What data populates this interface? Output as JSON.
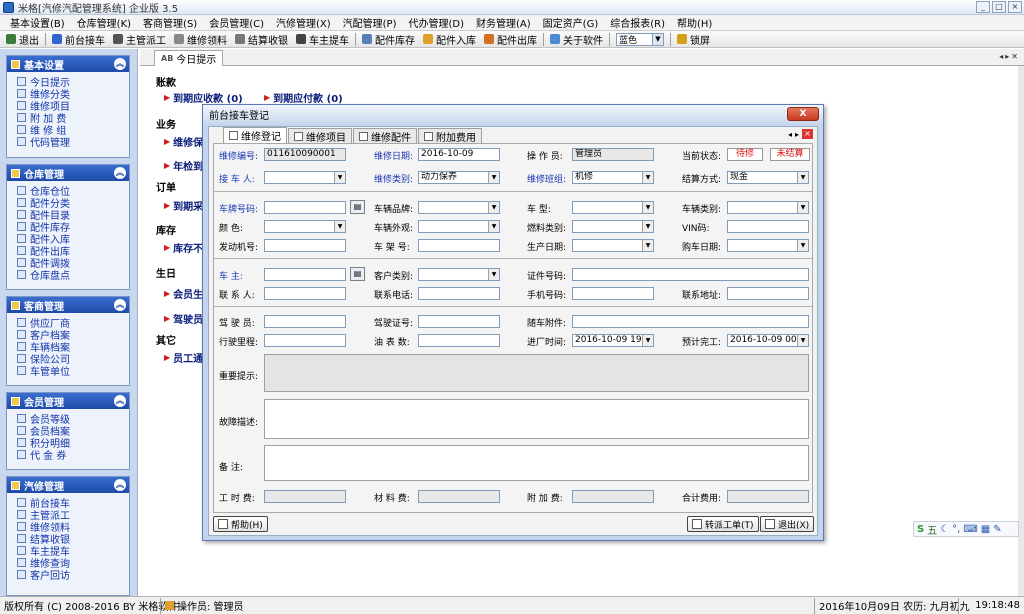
{
  "window": {
    "title": "米格[汽修汽配管理系统] 企业版 3.5"
  },
  "menu": [
    "基本设置(B)",
    "仓库管理(K)",
    "客商管理(S)",
    "会员管理(C)",
    "汽修管理(X)",
    "汽配管理(P)",
    "代办管理(D)",
    "财务管理(A)",
    "固定资产(G)",
    "综合报表(R)",
    "帮助(H)"
  ],
  "toolbar": {
    "items": [
      "退出",
      "前台接车",
      "主管派工",
      "维修领料",
      "结算收银",
      "车主提车",
      "配件库存",
      "配件入库",
      "配件出库",
      "关于软件"
    ],
    "theme_value": "蓝色",
    "lock_label": "锁屏"
  },
  "sidebar": {
    "panels": [
      {
        "title": "基本设置",
        "items": [
          "今日提示",
          "维修分类",
          "维修项目",
          "附 加 费",
          "维 修 组",
          "代码管理"
        ]
      },
      {
        "title": "仓库管理",
        "items": [
          "仓库仓位",
          "配件分类",
          "配件目录",
          "配件库存",
          "配件入库",
          "配件出库",
          "配件调拨",
          "仓库盘点"
        ]
      },
      {
        "title": "客商管理",
        "items": [
          "供应厂商",
          "客户档案",
          "车辆档案",
          "保险公司",
          "车管单位"
        ]
      },
      {
        "title": "会员管理",
        "items": [
          "会员等级",
          "会员档案",
          "积分明细",
          "代 金 券"
        ]
      },
      {
        "title": "汽修管理",
        "items": [
          "前台接车",
          "主管派工",
          "维修领料",
          "结算收银",
          "车主提车",
          "维修查询",
          "客户回访"
        ]
      }
    ]
  },
  "tab": {
    "label": "今日提示",
    "icon_text": "AB"
  },
  "reminders": {
    "sections": {
      "s1": "账款",
      "s2": "业务",
      "s3": "订单",
      "s4": "库存",
      "s5": "生日",
      "s6": "其它"
    },
    "links": {
      "l1": "到期应收款 (0)",
      "l2": "到期应付款 (0)",
      "l3": "维修保",
      "l4": "年检到",
      "l5": "到期采",
      "l6": "库存不",
      "l7": "会员生",
      "l8": "驾驶员",
      "l9": "员工通"
    }
  },
  "dialog": {
    "title": "前台接车登记",
    "close_label": "X",
    "tabs": [
      "维修登记",
      "维修项目",
      "维修配件",
      "附加费用"
    ],
    "form": {
      "wxbh": {
        "label": "维修编号:",
        "value": "011610090001"
      },
      "wxrq": {
        "label": "维修日期:",
        "value": "2016-10-09"
      },
      "czy": {
        "label": "操 作 员:",
        "value": "管理员"
      },
      "dqzt": {
        "label": "当前状态:",
        "status1": "待修",
        "status2": "未结算"
      },
      "jcr": {
        "label": "接 车 人:",
        "value": ""
      },
      "wxlb": {
        "label": "维修类别:",
        "value": "动力保养"
      },
      "wxbz": {
        "label": "维修班组:",
        "value": "机修"
      },
      "jsfs": {
        "label": "结算方式:",
        "value": "现金"
      },
      "cphm": {
        "label": "车牌号码:",
        "value": ""
      },
      "clpp": {
        "label": "车辆品牌:",
        "value": ""
      },
      "cx": {
        "label": "车 型:",
        "value": ""
      },
      "cllb": {
        "label": "车辆类别:",
        "value": ""
      },
      "ys": {
        "label": "颜 色:",
        "value": ""
      },
      "clwg": {
        "label": "车辆外观:",
        "value": ""
      },
      "rylb": {
        "label": "燃料类别:",
        "value": ""
      },
      "vin": {
        "label": "VIN码:",
        "value": ""
      },
      "fdjh": {
        "label": "发动机号:",
        "value": ""
      },
      "cjh": {
        "label": "车 架 号:",
        "value": ""
      },
      "scrq": {
        "label": "生产日期:",
        "value": ""
      },
      "gcrq": {
        "label": "购车日期:",
        "value": ""
      },
      "cz": {
        "label": "车 主:",
        "value": ""
      },
      "khlb": {
        "label": "客户类别:",
        "value": ""
      },
      "zjhm": {
        "label": "证件号码:",
        "value": ""
      },
      "lxr": {
        "label": "联 系 人:",
        "value": ""
      },
      "lxdh": {
        "label": "联系电话:",
        "value": ""
      },
      "sjhm": {
        "label": "手机号码:",
        "value": ""
      },
      "lxdz": {
        "label": "联系地址:",
        "value": ""
      },
      "jsy": {
        "label": "驾 驶 员:",
        "value": ""
      },
      "jszh": {
        "label": "驾驶证号:",
        "value": ""
      },
      "scfj": {
        "label": "随车附件:",
        "value": ""
      },
      "xslc": {
        "label": "行驶里程:",
        "value": ""
      },
      "ybs": {
        "label": "油 表 数:",
        "value": ""
      },
      "jcsj": {
        "label": "进厂时间:",
        "value": "2016-10-09 19:18"
      },
      "ywsj": {
        "label": "预计完工:",
        "value": "2016-10-09 00:00"
      },
      "zyts": {
        "label": "重要提示:"
      },
      "gzms": {
        "label": "故障描述:"
      },
      "bz": {
        "label": "备 注:"
      },
      "gsf": {
        "label": "工 时 费:",
        "value": ""
      },
      "clf": {
        "label": "材 料 费:",
        "value": ""
      },
      "fjf": {
        "label": "附 加 费:",
        "value": ""
      },
      "hjfy": {
        "label": "合计费用:",
        "value": ""
      }
    },
    "buttons": {
      "help": "帮助(H)",
      "dispatch": "转派工单(T)",
      "exit": "退出(X)"
    }
  },
  "statusbar": {
    "copyright": "版权所有 (C) 2008-2016 BY 米格软件",
    "operator": "操作员: 管理员",
    "date": "2016年10月09日 农历: 九月初九",
    "time": "19:18:48"
  },
  "tray": {
    "ime": "五"
  }
}
